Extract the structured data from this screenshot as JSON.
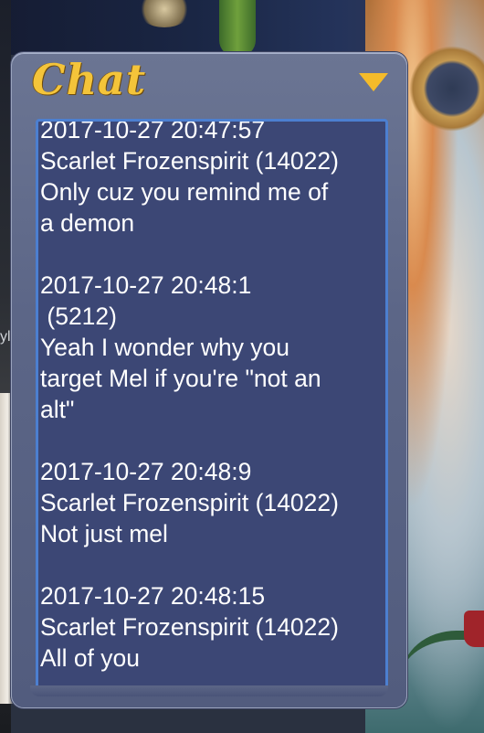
{
  "chat": {
    "title": "Chat",
    "toggle_icon": "triangle-down-icon",
    "accent_color": "#f4c43a",
    "messages": [
      {
        "timestamp": "2017-10-27 20:47:57",
        "sender": "Scarlet Frozenspirit (14022)",
        "lines": [
          "Only cuz you remind me of",
          "a demon"
        ]
      },
      {
        "timestamp": "2017-10-27 20:48:1",
        "sender": " (5212)",
        "lines": [
          "Yeah I wonder why you",
          "target Mel if you're \"not an",
          "alt\""
        ]
      },
      {
        "timestamp": "2017-10-27 20:48:9",
        "sender": "Scarlet Frozenspirit (14022)",
        "lines": [
          "Not just mel"
        ]
      },
      {
        "timestamp": "2017-10-27 20:48:15",
        "sender": "Scarlet Frozenspirit (14022)",
        "lines": [
          "All of you"
        ]
      }
    ]
  },
  "background": {
    "left_edge_mark": "yl"
  }
}
